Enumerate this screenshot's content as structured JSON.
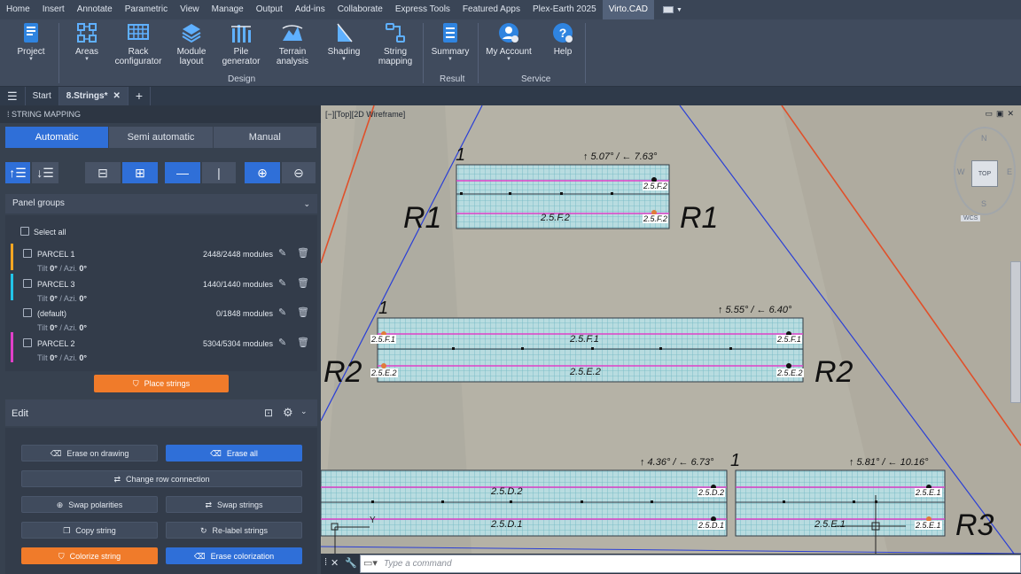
{
  "menu": {
    "tabs": [
      "Home",
      "Insert",
      "Annotate",
      "Parametric",
      "View",
      "Manage",
      "Output",
      "Add-ins",
      "Collaborate",
      "Express Tools",
      "Featured Apps",
      "Plex-Earth 2025",
      "Virto.CAD"
    ]
  },
  "ribbon": {
    "project": "Project",
    "areas": "Areas",
    "rack1": "Rack",
    "rack2": "configurator",
    "module1": "Module",
    "module2": "layout",
    "pile1": "Pile",
    "pile2": "generator",
    "terrain1": "Terrain",
    "terrain2": "analysis",
    "shading": "Shading",
    "string1": "String",
    "string2": "mapping",
    "summary": "Summary",
    "account": "My Account",
    "help": "Help",
    "panel_design": "Design",
    "panel_result": "Result",
    "panel_service": "Service"
  },
  "docbar": {
    "start": "Start",
    "file": "8.Strings*"
  },
  "left": {
    "title": "STRING MAPPING",
    "modes": {
      "automatic": "Automatic",
      "semi": "Semi automatic",
      "manual": "Manual"
    },
    "groups_header": "Panel groups",
    "select_all": "Select all",
    "groups": [
      {
        "name": "PARCEL 1",
        "count": "2448/2448 modules",
        "tilt": "0°",
        "azi": "0°",
        "color": "#f5a623"
      },
      {
        "name": "PARCEL 3",
        "count": "1440/1440 modules",
        "tilt": "0°",
        "azi": "0°",
        "color": "#22c4e8"
      },
      {
        "name": "(default)",
        "count": "0/1848 modules",
        "tilt": "0°",
        "azi": "0°",
        "color": ""
      },
      {
        "name": "PARCEL 2",
        "count": "5304/5304 modules",
        "tilt": "0°",
        "azi": "0°",
        "color": "#e040c8"
      }
    ],
    "tilt_label": "Tilt",
    "azi_label": "/ Azi.",
    "place_strings": "Place strings",
    "edit_title": "Edit",
    "buttons": {
      "erase_drawing": "Erase on drawing",
      "erase_all": "Erase all",
      "change_row": "Change row connection",
      "swap_polarities": "Swap polarities",
      "swap_strings": "Swap strings",
      "copy_string": "Copy string",
      "relabel": "Re-label strings",
      "colorize": "Colorize string",
      "erase_colorization": "Erase colorization"
    }
  },
  "viewport": {
    "label": "[−][Top][2D Wireframe]",
    "cube_top": "TOP",
    "wcs": "WCS",
    "compass": {
      "n": "N",
      "w": "W",
      "s": "S",
      "e": "E"
    },
    "rows": {
      "r1": "R1",
      "r2": "R2",
      "r3": "R3",
      "one": "1",
      "angle1": "↑ 5.07° / ← 7.63°",
      "angle2": "↑ 5.55° / ← 6.40°",
      "angle3": "↑ 4.36° / ← 6.73°",
      "angle4": "↑ 5.81° / ← 10.16°",
      "f2": "2.5.F.2",
      "f1": "2.5.F.1",
      "e2": "2.5.E.2",
      "d2": "2.5.D.2",
      "d1": "2.5.D.1",
      "e1": "2.5.E.1",
      "y": "Y"
    }
  },
  "command": {
    "placeholder": "Type a command"
  }
}
